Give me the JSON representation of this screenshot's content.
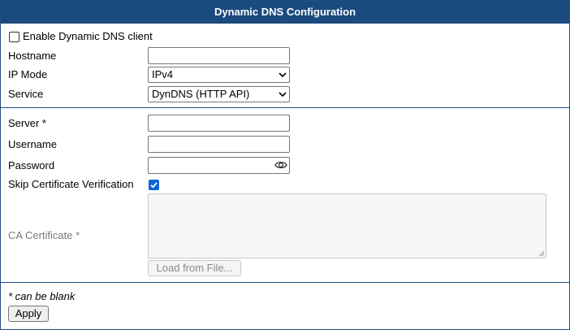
{
  "header": {
    "title": "Dynamic DNS Configuration"
  },
  "enable": {
    "label": "Enable Dynamic DNS client",
    "checked": false
  },
  "hostname": {
    "label": "Hostname",
    "value": ""
  },
  "ip_mode": {
    "label": "IP Mode",
    "selected": "IPv4"
  },
  "service": {
    "label": "Service",
    "selected": "DynDNS (HTTP API)"
  },
  "server": {
    "label": "Server *",
    "value": ""
  },
  "username": {
    "label": "Username",
    "value": ""
  },
  "password": {
    "label": "Password",
    "value": "",
    "icon": "eye-icon"
  },
  "skip_cert": {
    "label": "Skip Certificate Verification",
    "checked": true
  },
  "ca_cert": {
    "label": "CA Certificate *",
    "value": "",
    "load_button": "Load from File..."
  },
  "footer": {
    "note": "* can be blank",
    "apply_button": "Apply"
  },
  "colors": {
    "header_bg": "#1b4a7e",
    "checkbox_accent": "#0b64d6"
  }
}
